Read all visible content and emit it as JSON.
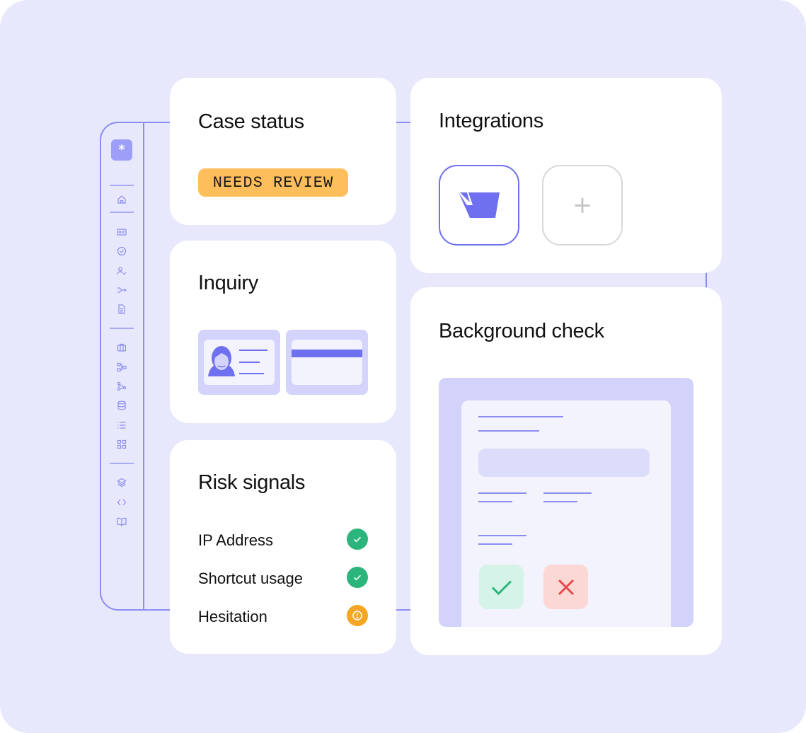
{
  "cards": {
    "case_status": {
      "title": "Case status",
      "badge": "NEEDS REVIEW",
      "badge_color": "#fdbe5b"
    },
    "inquiry": {
      "title": "Inquiry",
      "documents": [
        "id-card-icon",
        "card-back-icon"
      ]
    },
    "integrations": {
      "title": "Integrations",
      "add_label": "+",
      "tiles": [
        "integration-logo-icon",
        "add-integration-icon"
      ]
    },
    "risk_signals": {
      "title": "Risk signals",
      "items": [
        {
          "label": "IP Address",
          "status": "pass",
          "color": "#2bb57c"
        },
        {
          "label": "Shortcut usage",
          "status": "pass",
          "color": "#2bb57c"
        },
        {
          "label": "Hesitation",
          "status": "warning",
          "color": "#f5a623"
        }
      ]
    },
    "background_check": {
      "title": "Background check",
      "actions": [
        "approve-icon",
        "reject-icon"
      ]
    }
  },
  "sidebar": {
    "logo": "*",
    "icons": [
      "home-icon",
      "id-card-icon",
      "check-circle-icon",
      "user-check-icon",
      "flow-icon",
      "document-icon",
      "briefcase-icon",
      "workflow-icon",
      "graph-icon",
      "database-icon",
      "list-icon",
      "grid-icon",
      "layers-icon",
      "code-icon",
      "book-icon"
    ]
  },
  "colors": {
    "background": "#e8e8fd",
    "accent": "#6f70f0",
    "accent_light": "#d3d3fb",
    "success": "#2bb57c",
    "warning": "#f5a623",
    "danger": "#e5484d"
  }
}
